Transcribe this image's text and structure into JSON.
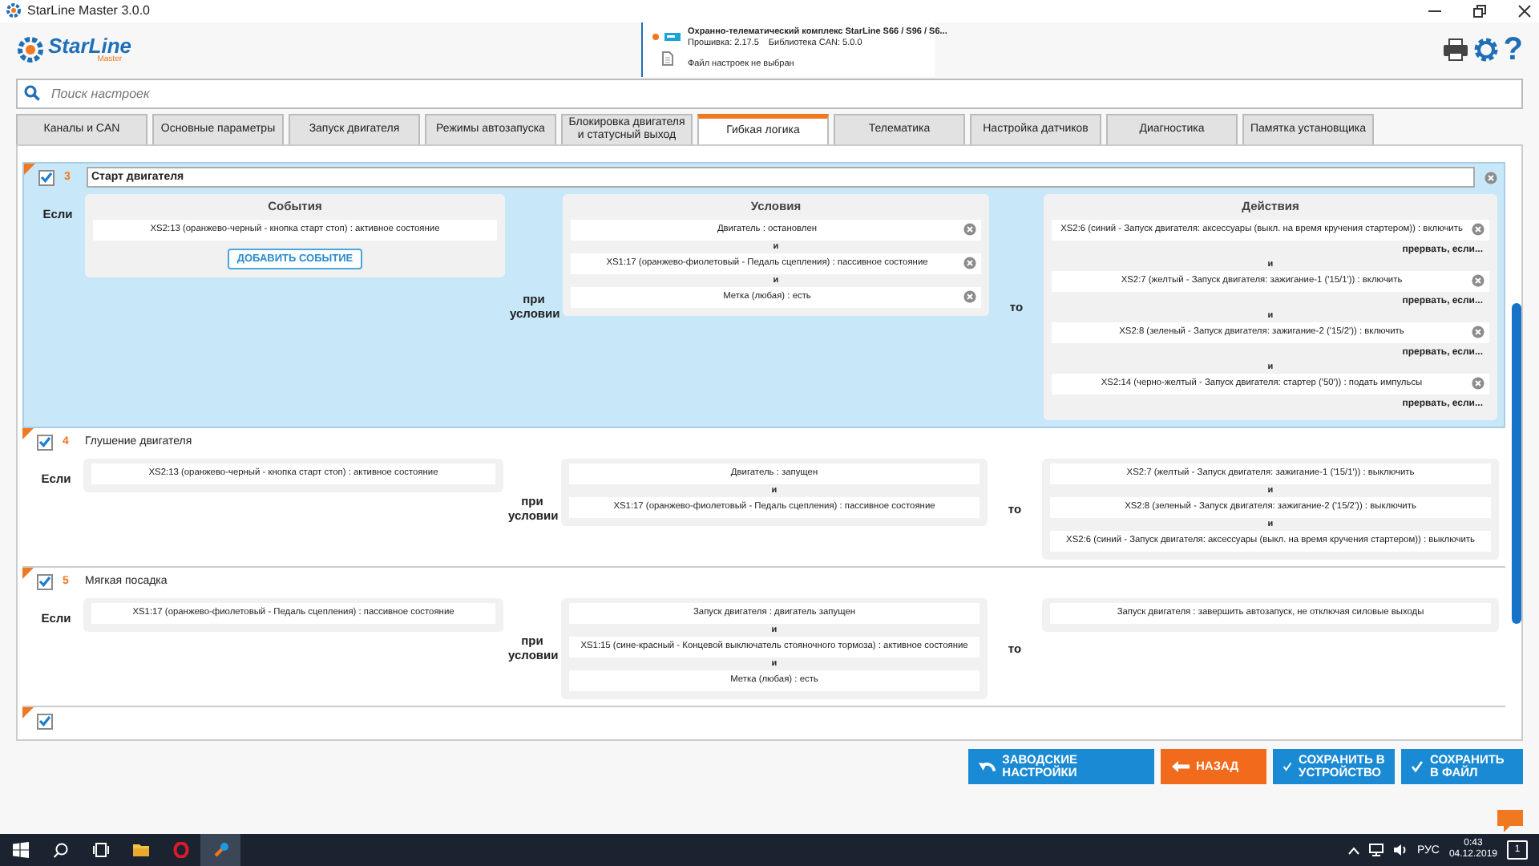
{
  "window": {
    "title": "StarLine Master 3.0.0"
  },
  "header": {
    "logo": {
      "name": "StarLine",
      "sub": "Master"
    },
    "device": {
      "connected": true,
      "title": "Охранно-телематический комплекс StarLine S66 / S96 / S6...",
      "firmware": "Прошивка: 2.17.5",
      "can_library": "Библиотека CAN: 5.0.0",
      "settings_file": "Файл настроек не выбран"
    },
    "help": "?"
  },
  "search": {
    "placeholder": "Поиск настроек"
  },
  "tabs": [
    {
      "label": "Каналы и CAN",
      "selected": false
    },
    {
      "label": "Основные параметры",
      "selected": false
    },
    {
      "label": "Запуск двигателя",
      "selected": false
    },
    {
      "label": "Режимы автозапуска",
      "selected": false
    },
    {
      "label": "Блокировка двигателя и статусный выход",
      "selected": false
    },
    {
      "label": "Гибкая логика",
      "selected": true
    },
    {
      "label": "Телематика",
      "selected": false
    },
    {
      "label": "Настройка датчиков",
      "selected": false
    },
    {
      "label": "Диагностика",
      "selected": false
    },
    {
      "label": "Памятка установщика",
      "selected": false
    }
  ],
  "rules": [
    {
      "number": "3",
      "title": "Старт двигателя",
      "enabled": true,
      "selected": true,
      "if_label": "Если",
      "condition_label": "при условии",
      "then_label": "то",
      "events": {
        "heading": "События",
        "add_button": "ДОБАВИТЬ СОБЫТИЕ",
        "items": [
          {
            "text": "XS2:13 (оранжево-черный - кнопка старт стоп) : активное состояние",
            "removable": false
          }
        ]
      },
      "conditions": {
        "heading": "Условия",
        "items": [
          {
            "text": "Двигатель : остановлен",
            "removable": true
          },
          {
            "joiner": "и",
            "text": "XS1:17 (оранжево-фиолетовый - Педаль сцепления) : пассивное состояние",
            "removable": true
          },
          {
            "joiner": "и",
            "text": "Метка (любая) : есть",
            "removable": true
          }
        ]
      },
      "actions": {
        "heading": "Действия",
        "items": [
          {
            "text": "XS2:6 (синий - Запуск двигателя: аксессуары (выкл. на время кручения стартером)) : включить",
            "removable": true,
            "interrupt": "прервать, если..."
          },
          {
            "joiner": "и",
            "text": "XS2:7 (желтый - Запуск двигателя: зажигание-1 ('15/1')) : включить",
            "removable": true,
            "interrupt": "прервать, если..."
          },
          {
            "joiner": "и",
            "text": "XS2:8 (зеленый - Запуск двигателя: зажигание-2 ('15/2')) : включить",
            "removable": true,
            "interrupt": "прервать, если..."
          },
          {
            "joiner": "и",
            "text": "XS2:14 (черно-желтый - Запуск двигателя: стартер ('50')) : подать импульсы",
            "removable": true,
            "interrupt": "прервать, если..."
          }
        ]
      }
    },
    {
      "number": "4",
      "title": "Глушение двигателя",
      "enabled": true,
      "selected": false,
      "if_label": "Если",
      "condition_label": "при условии",
      "then_label": "то",
      "events": {
        "items": [
          {
            "text": "XS2:13 (оранжево-черный - кнопка старт стоп) : активное состояние",
            "removable": false
          }
        ]
      },
      "conditions": {
        "items": [
          {
            "text": "Двигатель : запущен",
            "removable": false
          },
          {
            "joiner": "и",
            "text": "XS1:17 (оранжево-фиолетовый - Педаль сцепления) : пассивное состояние",
            "removable": false
          }
        ]
      },
      "actions": {
        "items": [
          {
            "text": "XS2:7 (желтый - Запуск двигателя: зажигание-1 ('15/1')) : выключить",
            "removable": false
          },
          {
            "joiner": "и",
            "text": "XS2:8 (зеленый - Запуск двигателя: зажигание-2 ('15/2')) : выключить",
            "removable": false
          },
          {
            "joiner": "и",
            "text": "XS2:6 (синий - Запуск двигателя: аксессуары (выкл. на время кручения стартером)) : выключить",
            "removable": false
          }
        ]
      }
    },
    {
      "number": "5",
      "title": "Мягкая посадка",
      "enabled": true,
      "selected": false,
      "if_label": "Если",
      "condition_label": "при условии",
      "then_label": "то",
      "events": {
        "items": [
          {
            "text": "XS1:17 (оранжево-фиолетовый - Педаль сцепления) : пассивное состояние",
            "removable": false
          }
        ]
      },
      "conditions": {
        "items": [
          {
            "text": "Запуск двигателя : двигатель запущен",
            "removable": false
          },
          {
            "joiner": "и",
            "text": "XS1:15 (сине-красный - Концевой выключатель стояночного тормоза) : активное состояние",
            "removable": false
          },
          {
            "joiner": "и",
            "text": "Метка (любая) : есть",
            "removable": false
          }
        ]
      },
      "actions": {
        "items": [
          {
            "text": "Запуск двигателя : завершить автозапуск, не отключая силовые выходы",
            "removable": false
          }
        ]
      }
    }
  ],
  "next_rule": {
    "enabled": true
  },
  "buttons": [
    {
      "label": "ЗАВОДСКИЕ НАСТРОЙКИ",
      "kind": "reset"
    },
    {
      "label": "НАЗАД",
      "kind": "back"
    },
    {
      "label": "СОХРАНИТЬ В УСТРОЙСТВО",
      "kind": "save"
    },
    {
      "label": "СОХРАНИТЬ В ФАЙЛ",
      "kind": "save"
    }
  ],
  "taskbar": {
    "apps": [
      {
        "kind": "search",
        "selected": false
      },
      {
        "kind": "taskview",
        "selected": false
      },
      {
        "kind": "folder",
        "selected": false
      },
      {
        "kind": "ring",
        "selected": false
      },
      {
        "kind": "wrench",
        "selected": true
      }
    ],
    "language": "РУС",
    "time": "0:43",
    "date": "04.12.2019",
    "notifications": "1"
  }
}
